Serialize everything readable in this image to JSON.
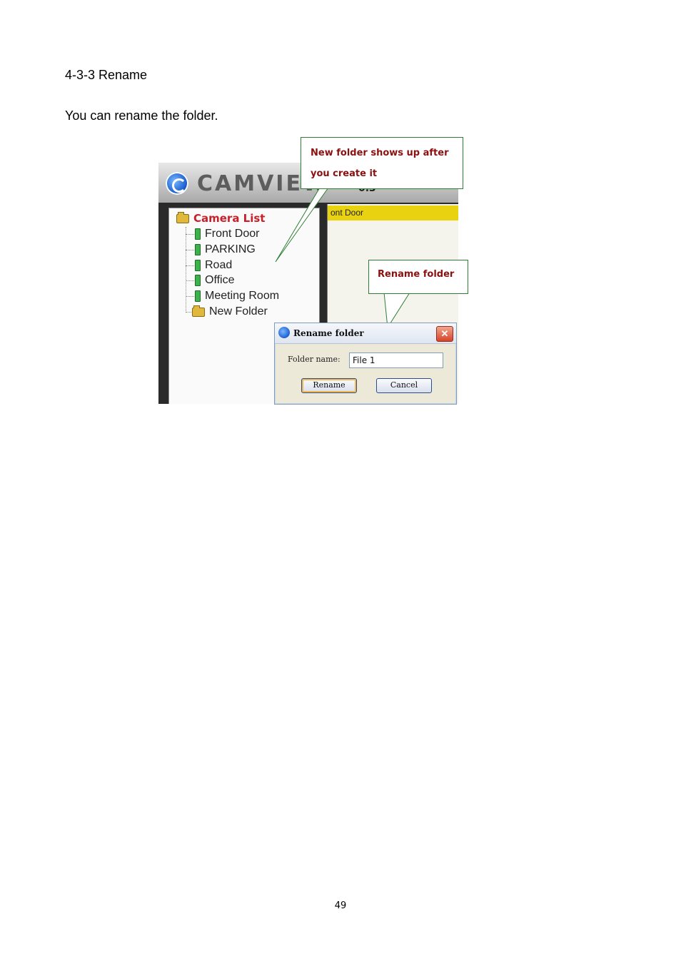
{
  "document": {
    "heading": "4-3-3 Rename",
    "paragraph": "You can rename the folder.",
    "page_number": "49"
  },
  "app": {
    "name": "CAMVIEW",
    "version_fragment": "0.3",
    "tree": {
      "root": "Camera List",
      "items": [
        "Front Door",
        "PARKING",
        "Road",
        "Office",
        "Meeting Room",
        "New Folder"
      ]
    },
    "channel_banner": "ont Door"
  },
  "callouts": {
    "new_folder_line1": "New folder shows up after",
    "new_folder_line2": "you create it",
    "rename_folder": "Rename folder"
  },
  "dialog": {
    "title": "Rename folder",
    "close_glyph": "✕",
    "field_label": "Folder name:",
    "field_value": "File 1",
    "rename_button": "Rename",
    "cancel_button": "Cancel"
  }
}
